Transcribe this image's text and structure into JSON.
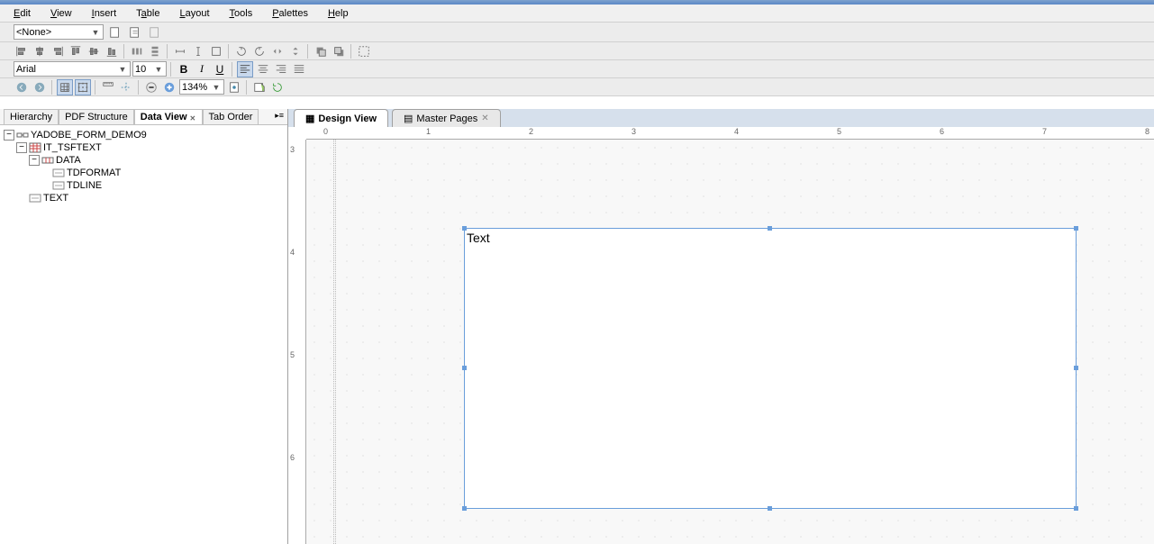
{
  "menu": {
    "edit": "Edit",
    "view": "View",
    "insert": "Insert",
    "table": "Table",
    "layout": "Layout",
    "tools": "Tools",
    "palettes": "Palettes",
    "help": "Help"
  },
  "toolbar1": {
    "style_combo": "<None>"
  },
  "toolbar3": {
    "font_combo": "Arial",
    "size_combo": "10"
  },
  "toolbar4": {
    "zoom_combo": "134%"
  },
  "leftTabs": {
    "hierarchy": "Hierarchy",
    "pdfstructure": "PDF Structure",
    "dataview": "Data View",
    "taborder": "Tab Order"
  },
  "tree": {
    "root": "YADOBE_FORM_DEMO9",
    "n1": "IT_TSFTEXT",
    "n2": "DATA",
    "n3": "TDFORMAT",
    "n4": "TDLINE",
    "n5": "TEXT"
  },
  "viewTabs": {
    "design": "Design View",
    "master": "Master Pages"
  },
  "hruler": {
    "t0": "0",
    "t1": "1",
    "t2": "2",
    "t3": "3",
    "t4": "4",
    "t5": "5",
    "t6": "6",
    "t7": "7",
    "t8": "8"
  },
  "vruler": {
    "t3": "3",
    "t4": "4",
    "t5": "5",
    "t6": "6"
  },
  "textField": {
    "label": "Text"
  }
}
